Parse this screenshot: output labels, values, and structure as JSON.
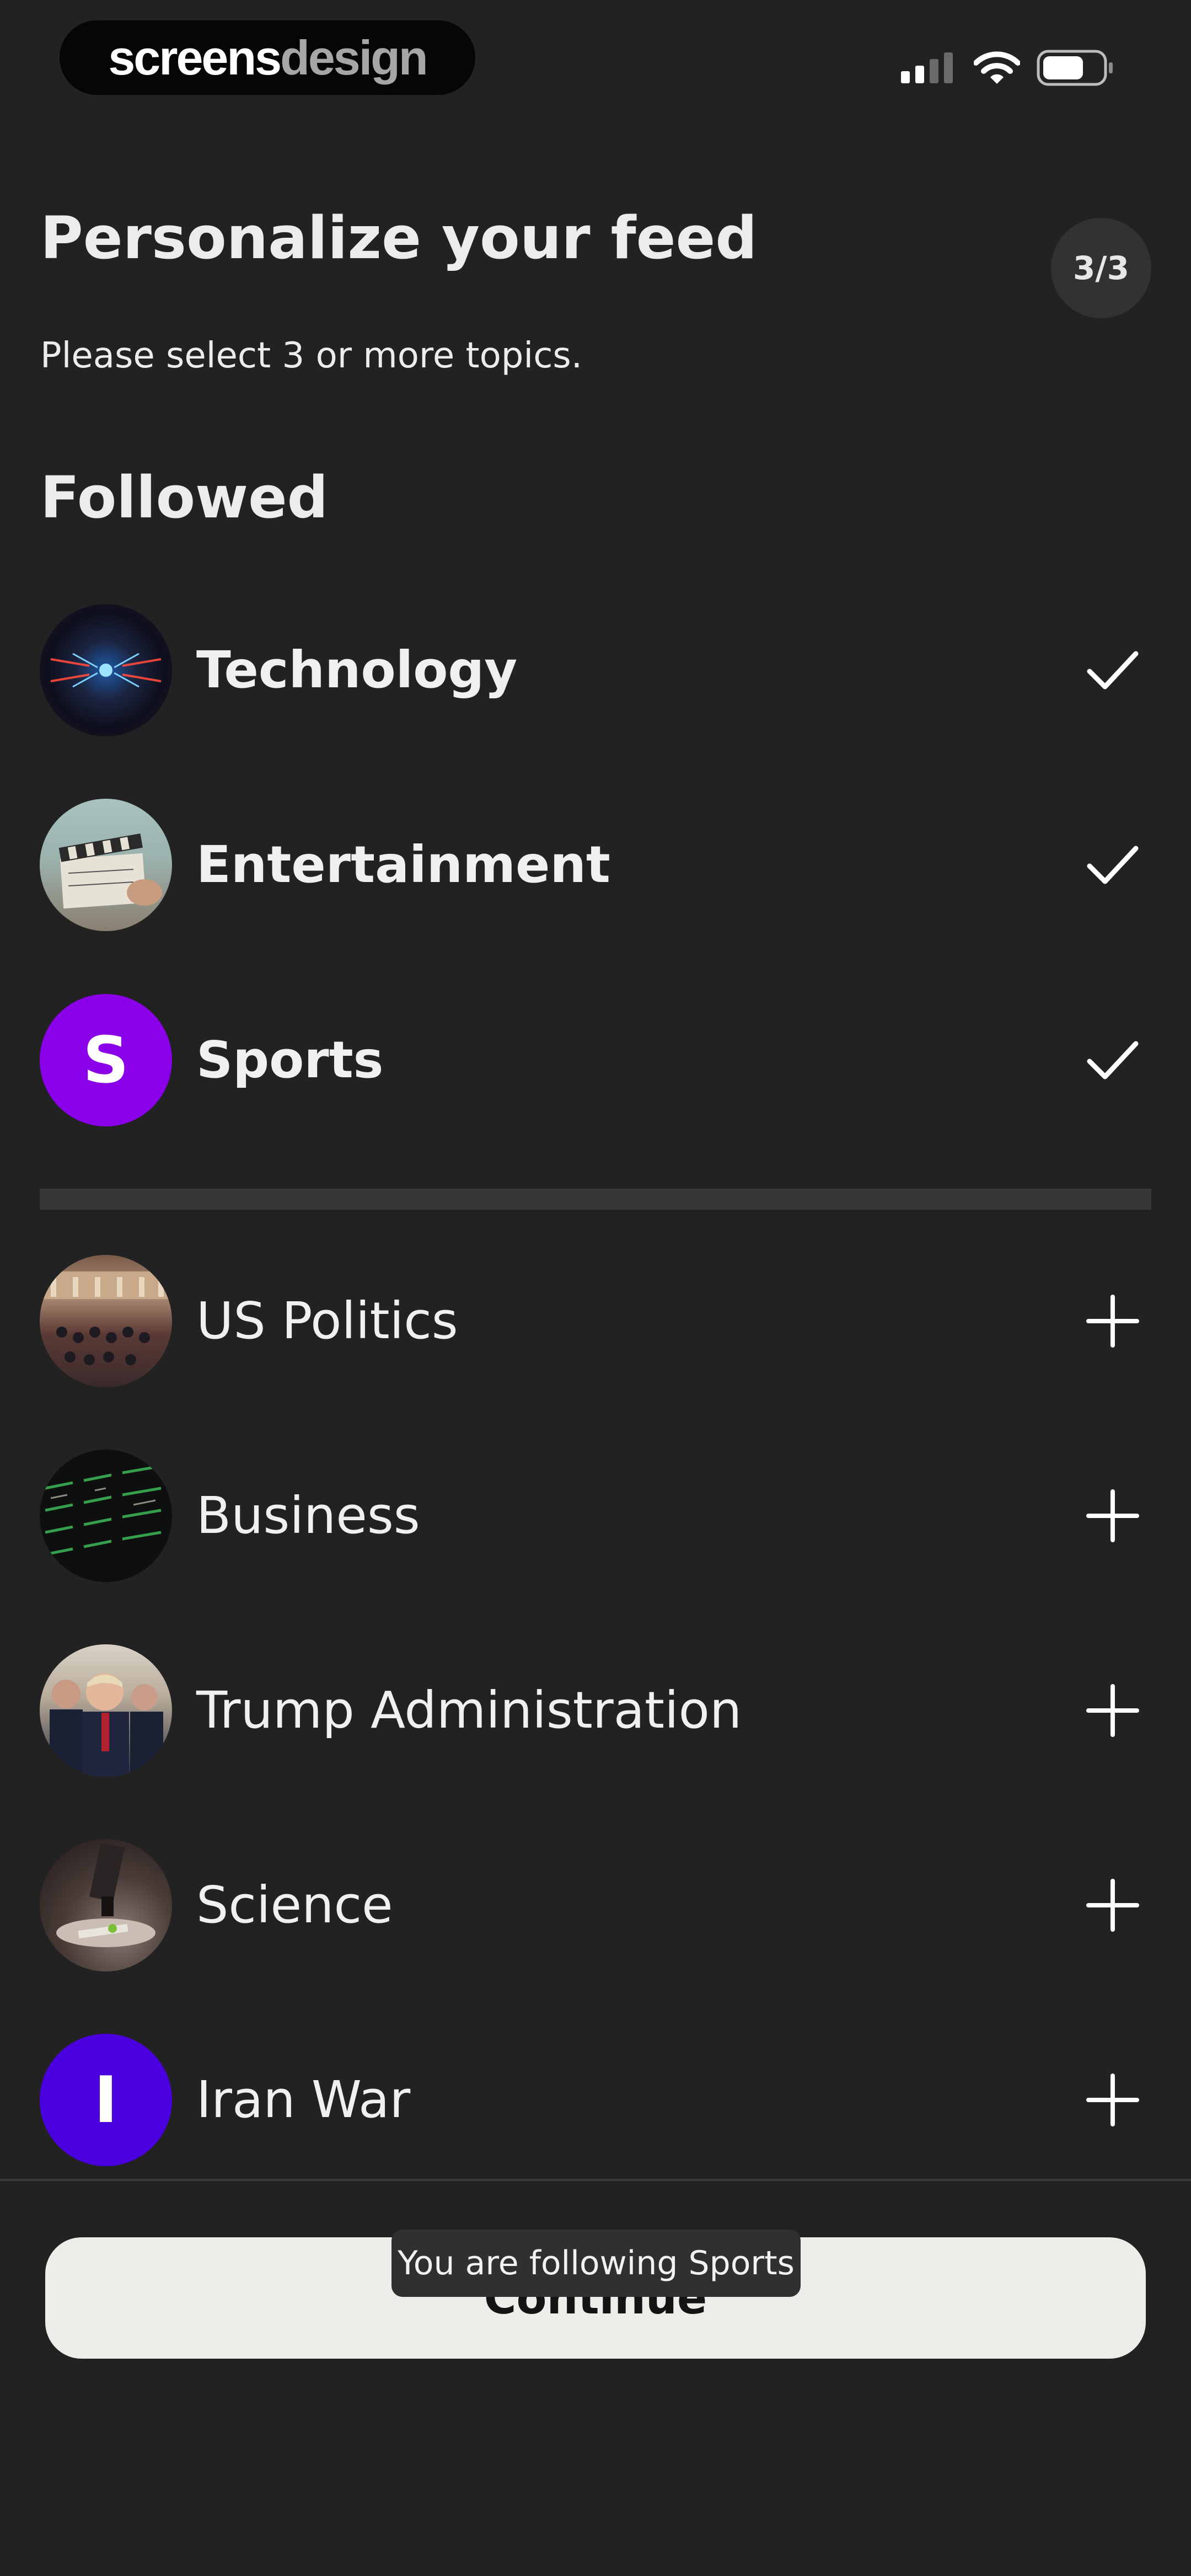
{
  "status_bar": {
    "brand_primary": "screens",
    "brand_secondary": "design",
    "signal_bars": 2,
    "battery_level": 0.7
  },
  "header": {
    "title": "Personalize your feed",
    "step_badge": "3/3",
    "subtitle": "Please select 3 or more topics."
  },
  "followed": {
    "heading": "Followed",
    "items": [
      {
        "label": "Technology",
        "avatar_icon": "technology-image-icon",
        "action_icon": "checkmark-icon"
      },
      {
        "label": "Entertainment",
        "avatar_icon": "clapperboard-image-icon",
        "action_icon": "checkmark-icon"
      },
      {
        "label": "Sports",
        "avatar_letter": "S",
        "avatar_color": "#8a00e8",
        "action_icon": "checkmark-icon"
      }
    ]
  },
  "suggested": {
    "items": [
      {
        "label": "US Politics",
        "avatar_icon": "congress-chamber-image-icon",
        "action_icon": "plus-icon"
      },
      {
        "label": "Business",
        "avatar_icon": "stock-ticker-image-icon",
        "action_icon": "plus-icon"
      },
      {
        "label": "Trump Administration",
        "avatar_icon": "administration-photo-icon",
        "action_icon": "plus-icon"
      },
      {
        "label": "Science",
        "avatar_icon": "microscope-image-icon",
        "action_icon": "plus-icon"
      },
      {
        "label": "Iran War",
        "avatar_letter": "I",
        "avatar_color": "#4b00e0",
        "action_icon": "plus-icon"
      }
    ]
  },
  "footer": {
    "continue_label": "Continue",
    "toast_text": "You are following Sports"
  },
  "colors": {
    "background": "#222223",
    "button": "#ededea",
    "sports_avatar": "#8a00e8",
    "iran_avatar": "#4b00e0"
  }
}
